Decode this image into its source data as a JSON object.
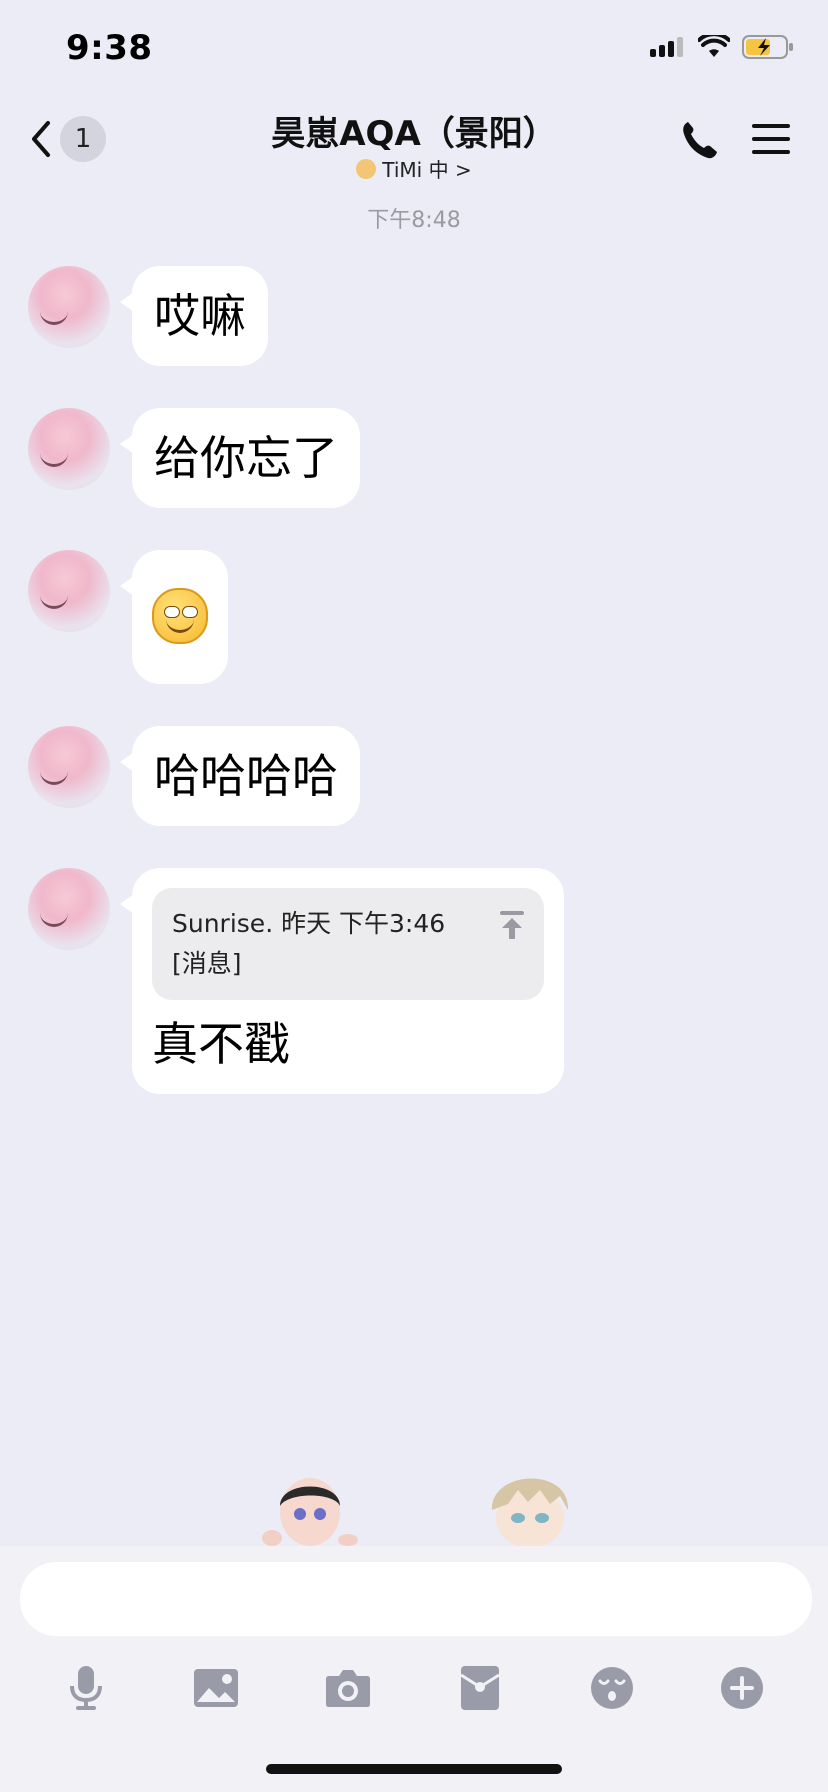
{
  "status_bar": {
    "time": "9:38",
    "battery_level": 0.55,
    "battery_color": "#f5c542"
  },
  "nav": {
    "back_badge": "1",
    "title": "昊崽AQA（景阳）",
    "subtitle": "TiMi 中 >"
  },
  "chat": {
    "timestamp": "下午8:48",
    "messages": [
      {
        "type": "text",
        "text": "哎嘛"
      },
      {
        "type": "text",
        "text": "给你忘了"
      },
      {
        "type": "emoji",
        "icon": "grin-face-emoji"
      },
      {
        "type": "text",
        "text": "哈哈哈哈"
      },
      {
        "type": "reply",
        "quote_header": "Sunrise. 昨天 下午3:46",
        "quote_body": "[消息]",
        "text": "真不戳"
      }
    ]
  },
  "input": {
    "placeholder": ""
  },
  "toolbar": {
    "tools": [
      "microphone-icon",
      "image-icon",
      "camera-icon",
      "red-packet-icon",
      "emoji-icon",
      "plus-icon"
    ],
    "icon_color": "#9a9ba8"
  }
}
